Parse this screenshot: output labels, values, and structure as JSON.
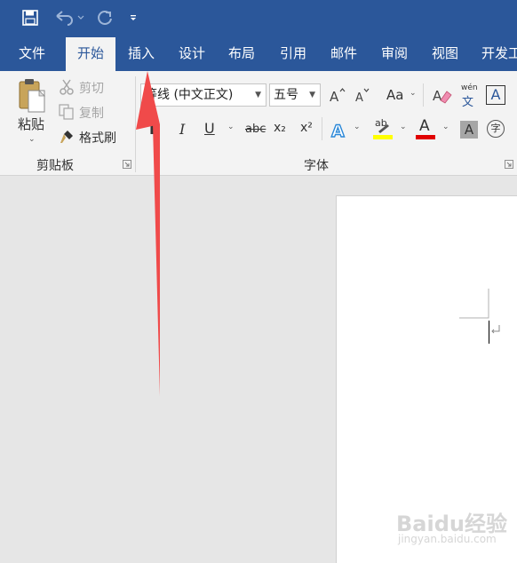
{
  "colors": {
    "accent": "#2b579a",
    "ribbon": "#f3f3f3",
    "arrow": "#f04a4a",
    "font_color_bar": "#e00000",
    "highlight_bar": "#ffff00"
  },
  "qat": {
    "icons": [
      "save-icon",
      "undo-icon",
      "redo-icon",
      "customize-qat-icon"
    ]
  },
  "tabs": [
    {
      "label": "文件"
    },
    {
      "label": "开始"
    },
    {
      "label": "插入"
    },
    {
      "label": "设计"
    },
    {
      "label": "布局"
    },
    {
      "label": "引用"
    },
    {
      "label": "邮件"
    },
    {
      "label": "审阅"
    },
    {
      "label": "视图"
    },
    {
      "label": "开发工"
    }
  ],
  "clipboard": {
    "paste": "粘贴",
    "cut": "剪切",
    "copy": "复制",
    "format_painter": "格式刷",
    "group_label": "剪贴板"
  },
  "font": {
    "font_name": "等线 (中文正文)",
    "font_size": "五号",
    "change_case": "Aa",
    "phonetic_top": "wén",
    "phonetic_bottom": "文",
    "char_border": "A",
    "bold": "B",
    "italic": "I",
    "underline": "U",
    "strike": "abc",
    "subscript": "x₂",
    "superscript": "x²",
    "highlight_text": "ab",
    "font_color_letter": "A",
    "shading_letter": "A",
    "enclose": "字",
    "group_label": "字体"
  },
  "watermark": {
    "line1": "Baidu经验",
    "line2": "jingyan.baidu.com"
  }
}
